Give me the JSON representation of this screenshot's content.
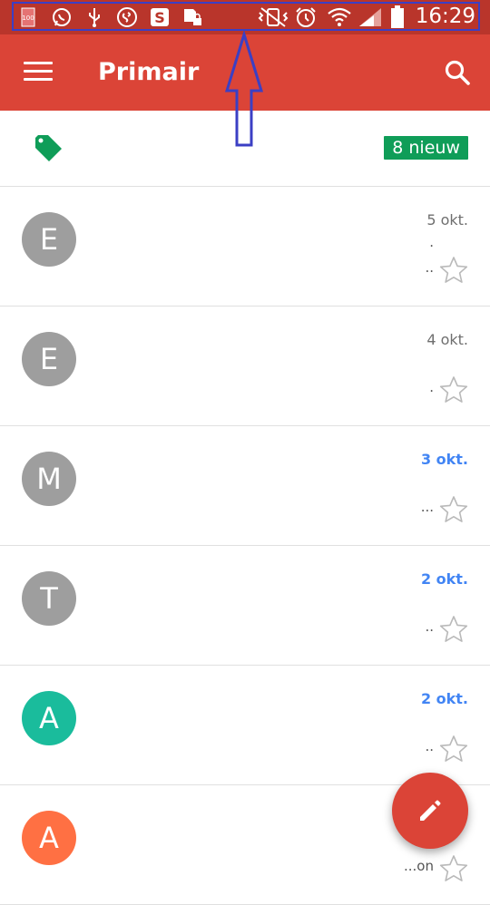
{
  "status_bar": {
    "time": "16:29",
    "battery_level_text": "100",
    "icons": [
      "battery-100-icon",
      "whatsapp-icon",
      "usb-icon",
      "shazam-icon",
      "skype-icon",
      "sd-card-icon",
      "vibrate-icon",
      "alarm-icon",
      "wifi-icon",
      "signal-icon",
      "battery-icon"
    ]
  },
  "app_bar": {
    "title": "Primair",
    "color": "#db4437"
  },
  "category": {
    "badge": "8 nieuw",
    "badge_color": "#0f9d58"
  },
  "emails": [
    {
      "initial": "E",
      "avatar_color": "#9e9e9e",
      "date": "5 okt.",
      "unread": false,
      "snippet": ".",
      "snippet2": ".."
    },
    {
      "initial": "E",
      "avatar_color": "#9e9e9e",
      "date": "4 okt.",
      "unread": false,
      "snippet": "",
      "snippet2": "."
    },
    {
      "initial": "M",
      "avatar_color": "#9e9e9e",
      "date": "3 okt.",
      "unread": true,
      "snippet": "",
      "snippet2": "..."
    },
    {
      "initial": "T",
      "avatar_color": "#9e9e9e",
      "date": "2 okt.",
      "unread": true,
      "snippet": "",
      "snippet2": ".."
    },
    {
      "initial": "A",
      "avatar_color": "#1abc9c",
      "date": "2 okt.",
      "unread": true,
      "snippet": "",
      "snippet2": ".."
    },
    {
      "initial": "A",
      "avatar_color": "#ff7043",
      "date": "",
      "unread": false,
      "snippet": "",
      "snippet2": "...on"
    }
  ]
}
